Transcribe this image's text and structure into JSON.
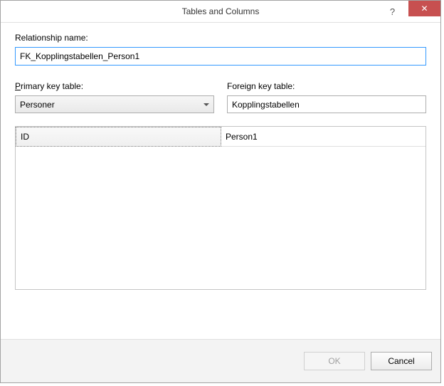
{
  "window": {
    "title": "Tables and Columns"
  },
  "labels": {
    "relationship_name": "Relationship name:",
    "primary_key_table": "Primary key table:",
    "foreign_key_table": "Foreign key table:"
  },
  "values": {
    "relationship_name": "FK_Kopplingstabellen_Person1",
    "primary_key_table": "Personer",
    "foreign_key_table": "Kopplingstabellen"
  },
  "grid": {
    "rows": [
      {
        "pk_column": "ID",
        "fk_column": "Person1"
      }
    ]
  },
  "buttons": {
    "ok": "OK",
    "cancel": "Cancel"
  }
}
